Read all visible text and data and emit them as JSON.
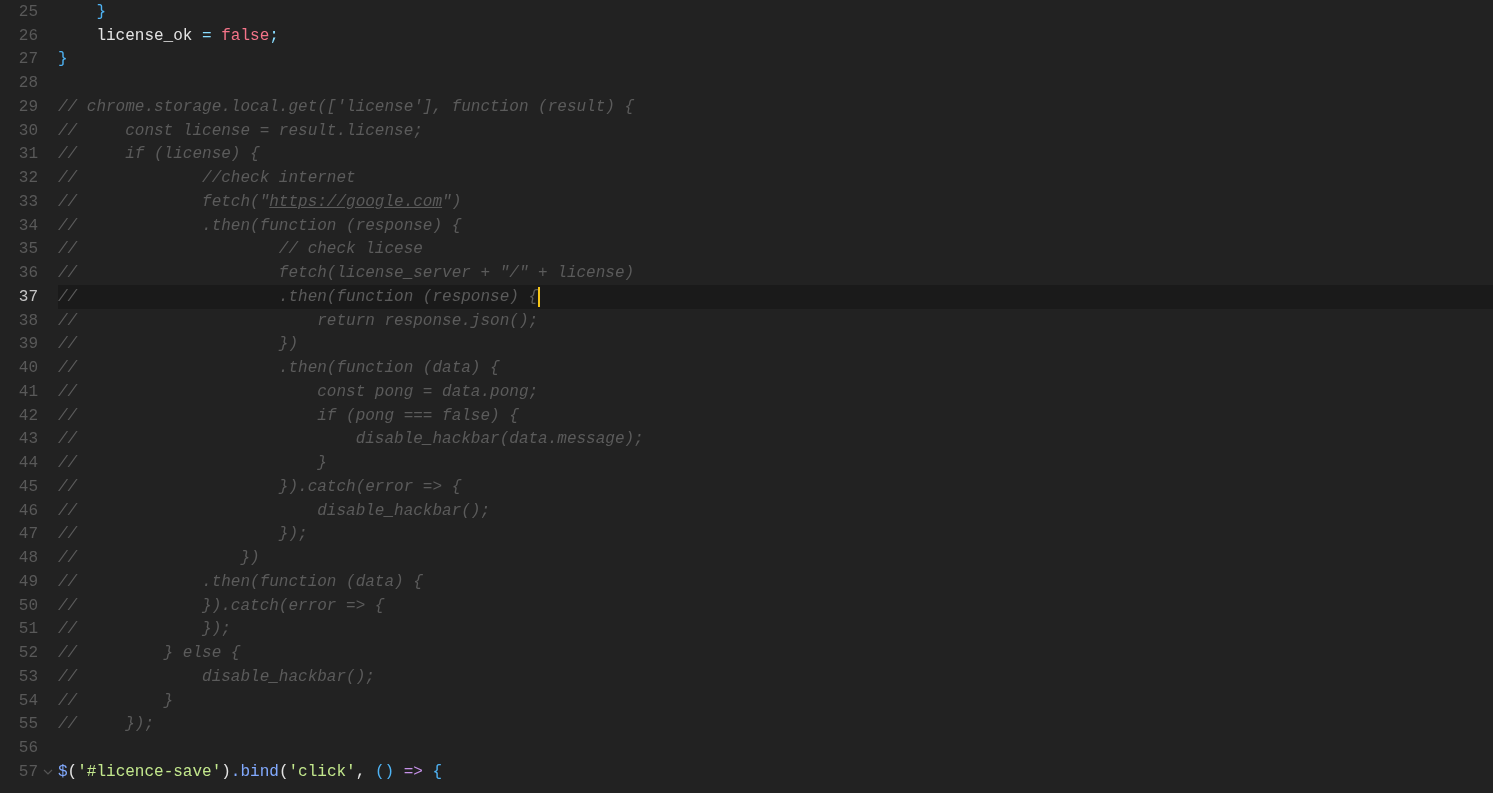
{
  "lines": [
    {
      "number": "25",
      "active": false,
      "tokens": [
        {
          "kind": "brace",
          "text": "    }"
        }
      ]
    },
    {
      "number": "26",
      "active": false,
      "tokens": [
        {
          "kind": "plain",
          "text": "    license_ok "
        },
        {
          "kind": "op",
          "text": "="
        },
        {
          "kind": "bool",
          "text": " false"
        },
        {
          "kind": "op",
          "text": ";"
        }
      ]
    },
    {
      "number": "27",
      "active": false,
      "tokens": [
        {
          "kind": "brace",
          "text": "}"
        }
      ]
    },
    {
      "number": "28",
      "active": false
    },
    {
      "number": "29",
      "active": false,
      "tokens": [
        {
          "kind": "comment",
          "text": "// chrome.storage.local.get(['license'], function (result) {"
        }
      ]
    },
    {
      "number": "30",
      "active": false,
      "tokens": [
        {
          "kind": "comment",
          "text": "//     const license = result.license;"
        }
      ]
    },
    {
      "number": "31",
      "active": false,
      "tokens": [
        {
          "kind": "comment",
          "text": "//     if (license) {"
        }
      ]
    },
    {
      "number": "32",
      "active": false,
      "tokens": [
        {
          "kind": "comment",
          "text": "//             //check internet"
        }
      ]
    },
    {
      "number": "33",
      "active": false,
      "tokens": [
        {
          "kind": "comment",
          "text": "//             fetch(\""
        },
        {
          "kind": "link",
          "text": "https://google.com"
        },
        {
          "kind": "comment",
          "text": "\")"
        }
      ]
    },
    {
      "number": "34",
      "active": false,
      "tokens": [
        {
          "kind": "comment",
          "text": "//             .then(function (response) {"
        }
      ]
    },
    {
      "number": "35",
      "active": false,
      "tokens": [
        {
          "kind": "comment",
          "text": "//                     // check licese"
        }
      ]
    },
    {
      "number": "36",
      "active": false,
      "tokens": [
        {
          "kind": "comment",
          "text": "//                     fetch(license_server + \"/\" + license)"
        }
      ]
    },
    {
      "number": "37",
      "active": true,
      "tokens": [
        {
          "kind": "comment",
          "text": "//                     .then(function (response) {"
        }
      ]
    },
    {
      "number": "38",
      "active": false,
      "tokens": [
        {
          "kind": "comment",
          "text": "//                         return response.json();"
        }
      ]
    },
    {
      "number": "39",
      "active": false,
      "tokens": [
        {
          "kind": "comment",
          "text": "//                     })"
        }
      ]
    },
    {
      "number": "40",
      "active": false,
      "tokens": [
        {
          "kind": "comment",
          "text": "//                     .then(function (data) {"
        }
      ]
    },
    {
      "number": "41",
      "active": false,
      "tokens": [
        {
          "kind": "comment",
          "text": "//                         const pong = data.pong;"
        }
      ]
    },
    {
      "number": "42",
      "active": false,
      "tokens": [
        {
          "kind": "comment",
          "text": "//                         if (pong === false) {"
        }
      ]
    },
    {
      "number": "43",
      "active": false,
      "tokens": [
        {
          "kind": "comment",
          "text": "//                             disable_hackbar(data.message);"
        }
      ]
    },
    {
      "number": "44",
      "active": false,
      "tokens": [
        {
          "kind": "comment",
          "text": "//                         }"
        }
      ]
    },
    {
      "number": "45",
      "active": false,
      "tokens": [
        {
          "kind": "comment",
          "text": "//                     }).catch(error => {"
        }
      ]
    },
    {
      "number": "46",
      "active": false,
      "tokens": [
        {
          "kind": "comment",
          "text": "//                         disable_hackbar();"
        }
      ]
    },
    {
      "number": "47",
      "active": false,
      "tokens": [
        {
          "kind": "comment",
          "text": "//                     });"
        }
      ]
    },
    {
      "number": "48",
      "active": false,
      "tokens": [
        {
          "kind": "comment",
          "text": "//                 })"
        }
      ]
    },
    {
      "number": "49",
      "active": false,
      "tokens": [
        {
          "kind": "comment",
          "text": "//             .then(function (data) {"
        }
      ]
    },
    {
      "number": "50",
      "active": false,
      "tokens": [
        {
          "kind": "comment",
          "text": "//             }).catch(error => {"
        }
      ]
    },
    {
      "number": "51",
      "active": false,
      "tokens": [
        {
          "kind": "comment",
          "text": "//             });"
        }
      ]
    },
    {
      "number": "52",
      "active": false,
      "tokens": [
        {
          "kind": "comment",
          "text": "//         } else {"
        }
      ]
    },
    {
      "number": "53",
      "active": false,
      "tokens": [
        {
          "kind": "comment",
          "text": "//             disable_hackbar();"
        }
      ]
    },
    {
      "number": "54",
      "active": false,
      "tokens": [
        {
          "kind": "comment",
          "text": "//         }"
        }
      ]
    },
    {
      "number": "55",
      "active": false,
      "tokens": [
        {
          "kind": "comment",
          "text": "//     });"
        }
      ]
    },
    {
      "number": "56",
      "active": false
    },
    {
      "number": "57",
      "active": false,
      "foldable": true,
      "tokens": [
        {
          "kind": "func",
          "text": "$"
        },
        {
          "kind": "plain",
          "text": "("
        },
        {
          "kind": "string",
          "text": "'#licence-save'"
        },
        {
          "kind": "plain",
          "text": ")"
        },
        {
          "kind": "func",
          "text": ".bind"
        },
        {
          "kind": "plain",
          "text": "("
        },
        {
          "kind": "string",
          "text": "'click'"
        },
        {
          "kind": "plain",
          "text": ", "
        },
        {
          "kind": "brace",
          "text": "()"
        },
        {
          "kind": "arrow",
          "text": " =>"
        },
        {
          "kind": "brace",
          "text": " {"
        }
      ]
    }
  ]
}
